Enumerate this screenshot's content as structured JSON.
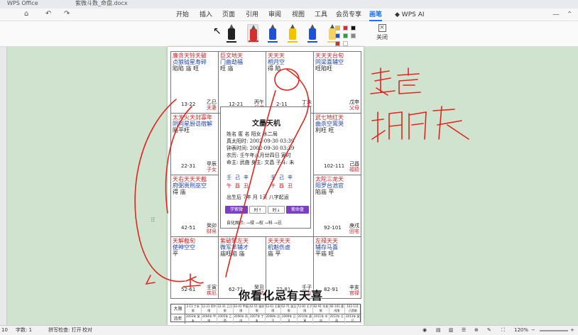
{
  "titlebar": {
    "tabs": [
      "WPS Office",
      "紫微斗数_命盘.docx"
    ]
  },
  "quick_access": {
    "undo": "↶",
    "redo": "↷",
    "save": "⌂"
  },
  "menu": {
    "items": [
      "开始",
      "插入",
      "页面",
      "引用",
      "审阅",
      "视图",
      "工具",
      "会员专享",
      "画笔"
    ],
    "active_index": 8,
    "wps_ai": "WPS AI"
  },
  "ribbon": {
    "pens": [
      {
        "name": "black-pen",
        "color": "#222222"
      },
      {
        "name": "red-pen",
        "color": "#d32f2f",
        "selected": true
      },
      {
        "name": "blue-pen",
        "color": "#1f4fd6"
      },
      {
        "name": "yellow-pen",
        "color": "#f2c200"
      },
      {
        "name": "blue-pen-2",
        "color": "#1f4fd6"
      },
      {
        "name": "highlighter-yellow",
        "color": "#f4d35e"
      }
    ],
    "swatches": [
      "#f2c200",
      "#d32f2f",
      "#111111",
      "#1f4fd6",
      "#2e9e3a",
      "#888888",
      "#d32f2f",
      "#ffffff"
    ],
    "close_label": "关闭"
  },
  "chart": {
    "title": "文墨天机",
    "info_lines": [
      "姓名  匿 名        阳女 水二局",
      "真太阳时: 2002-09-30 03:39",
      "钟表时间: 2002-09-30 03:39",
      "农历: 壬午年八月廿四日 寅时",
      "命主: 武曲 身主: 文昌  子斗: 未"
    ],
    "pillars_top": [
      "壬",
      "己",
      "辛",
      "壬",
      "己",
      "辛"
    ],
    "pillars_bottom": [
      "午",
      "酉",
      "丑",
      "午",
      "酉",
      "丑"
    ],
    "birth_line": "出生后 7年 月 1天 八字起运",
    "buttons": [
      {
        "label": "学紫微",
        "color": "#7b3fc4"
      },
      {
        "label": "时↑",
        "color": "plain"
      },
      {
        "label": "时↓",
        "color": "plain"
      },
      {
        "label": "紫命盘",
        "color": "#7b3fc4"
      }
    ],
    "legend_line": "自化图示: →禄 →权 →科 →忌",
    "cells": [
      {
        "stars": [
          [
            "r",
            "廉贪天铃天破"
          ],
          [
            "b",
            "贞狼钺星寿碎"
          ],
          [
            "k",
            "陷陷 庙 旺"
          ]
        ],
        "range": "13-22",
        "palace": "夫妻",
        "branch": "乙巳"
      },
      {
        "stars": [
          [
            "r",
            "巨文地天"
          ],
          [
            "b",
            "门曲劫福"
          ],
          [
            "k",
            "旺 庙"
          ]
        ],
        "range": "12-21",
        "palace": "兄弟",
        "branch": "丙午"
      },
      {
        "stars": [
          [
            "r",
            "天天天"
          ],
          [
            "b",
            "相月空"
          ],
          [
            "k",
            "得 陷"
          ]
        ],
        "range": "2-11",
        "palace": "命宫",
        "branch": "丁未"
      },
      {
        "stars": [
          [
            "r",
            "天天天台旬"
          ],
          [
            "b",
            "同梁喜辅空"
          ],
          [
            "k",
            "旺陷旺"
          ]
        ],
        "range": "",
        "palace": "父母",
        "branch": "戊申"
      },
      {
        "stars": [
          [
            "r",
            "太天火天封寡年"
          ],
          [
            "b",
            "阴同星厨诰宿解"
          ],
          [
            "k",
            "陷平旺"
          ]
        ],
        "range": "22-31",
        "palace": "子女",
        "branch": "甲辰"
      },
      {
        "stars": [
          [
            "r",
            "武七地红天"
          ],
          [
            "b",
            "曲杀空鸾哭"
          ],
          [
            "k",
            "利旺 旺"
          ]
        ],
        "range": "102-111",
        "palace": "福德",
        "branch": "己酉"
      },
      {
        "stars": [
          [
            "r",
            "天右天天天截"
          ],
          [
            "b",
            "府弼贵刑巫空"
          ],
          [
            "k",
            "得 庙"
          ]
        ],
        "range": "42-51",
        "palace": "财帛",
        "branch": "癸卯"
      },
      {
        "stars": [
          [
            "r",
            "太陀三龙天"
          ],
          [
            "b",
            "阳罗台池官"
          ],
          [
            "k",
            "陷庙 平"
          ]
        ],
        "range": "92-101",
        "palace": "田宅",
        "branch": "庚戌"
      },
      {
        "stars": [
          [
            "r",
            "天解截旬"
          ],
          [
            "b",
            "使神空空"
          ],
          [
            "k",
            "平"
          ]
        ],
        "range": "52-61",
        "palace": "疾厄",
        "branch": "壬寅"
      },
      {
        "stars": [
          [
            "r",
            "紫破擎左天"
          ],
          [
            "b",
            "微军羊辅才"
          ],
          [
            "k",
            "庙旺陷 庙"
          ]
        ],
        "range": "62-71",
        "palace": "迁移",
        "branch": "癸丑"
      },
      {
        "stars": [
          [
            "r",
            "天天天天"
          ],
          [
            "b",
            "机魁伤虚"
          ],
          [
            "k",
            "庙 平"
          ]
        ],
        "range": "72-81",
        "palace": "交友",
        "branch": "壬子"
      },
      {
        "stars": [
          [
            "r",
            "左禄天天"
          ],
          [
            "b",
            "辅存马喜"
          ],
          [
            "k",
            "平庙 旺"
          ]
        ],
        "range": "82-91",
        "palace": "官禄",
        "branch": "辛亥"
      }
    ],
    "bottom_table": {
      "row1_head": "大限",
      "row2_head": "流年",
      "row1": [
        "2-11 丁未限",
        "12-21 丙午限",
        "22-31 乙巳限",
        "32-41 甲辰限",
        "42-51 癸卯限",
        "52-61 壬寅限",
        "62-71 癸丑限",
        "72-81 壬子限",
        "82-91 辛亥限",
        "92-101 庚戌限",
        "102-111 己酉限"
      ],
      "row2": [
        "2003年 癸未",
        "2004年 甲申",
        "2005年 乙酉",
        "2006年 丙戌",
        "2007年 丁亥",
        "2008年 戊子",
        "2009年 己丑",
        "2010年 庚寅",
        "2011年 辛卯",
        "2012年 壬辰",
        "2013年 癸巳"
      ]
    }
  },
  "subtitle": "你看化忌有天喜",
  "status": {
    "page": "10",
    "words": "字数: 1",
    "spell": "拼写检查: 打开",
    "proof": "校对",
    "zoom": "120%"
  }
}
